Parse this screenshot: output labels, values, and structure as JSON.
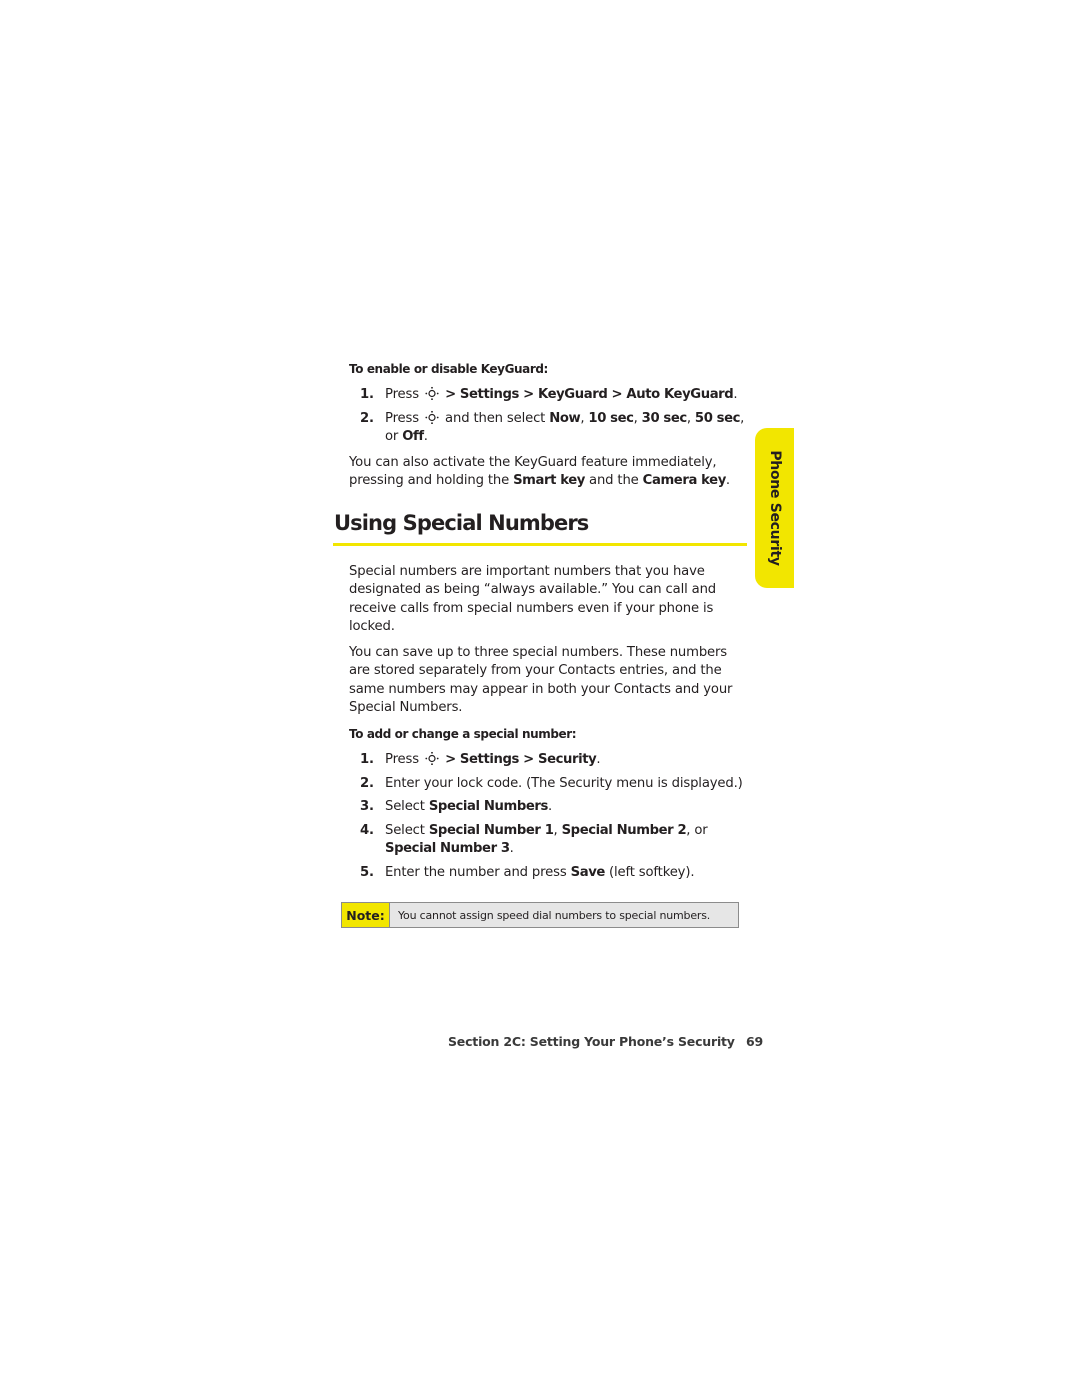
{
  "keyguard": {
    "subheading": "To enable or disable KeyGuard:",
    "steps": [
      {
        "num": "1.",
        "press": "Press",
        "path": "> Settings > KeyGuard > Auto KeyGuard",
        "end": "."
      },
      {
        "num": "2.",
        "press": "Press",
        "mid": " and then select ",
        "opt1": "Now",
        "sep1": ", ",
        "opt2": "10 sec",
        "sep2": ", ",
        "opt3": "30 sec",
        "sep3": ", ",
        "opt4": "50 sec",
        "sep4": ", or ",
        "opt5": "Off",
        "end": "."
      }
    ],
    "para_a": "You can also activate the KeyGuard feature immediately, pressing and holding the ",
    "smart_key": "Smart key",
    "para_b": " and the ",
    "camera_key": "Camera key",
    "para_end": "."
  },
  "section": {
    "heading": "Using Special Numbers",
    "tab_label": "Phone Security",
    "accent_color": "#f2e600",
    "para1": "Special numbers are important numbers that you have designated as being “always available.” You can call and receive calls from special numbers even if your phone is locked.",
    "para2": "You can save up to three special numbers. These numbers are stored separately from your Contacts entries, and the same numbers may appear in both your Contacts and your Special Numbers.",
    "subheading": "To add or change a special number:",
    "steps": [
      {
        "num": "1.",
        "press": "Press",
        "path": "> Settings > Security",
        "end": "."
      },
      {
        "num": "2.",
        "text": "Enter your lock code. (The Security menu is displayed.)"
      },
      {
        "num": "3.",
        "pre": "Select ",
        "bold": "Special Numbers",
        "end": "."
      },
      {
        "num": "4.",
        "pre": "Select ",
        "b1": "Special Number 1",
        "s1": ", ",
        "b2": "Special Number 2",
        "s2": ", or ",
        "b3": "Special Number 3",
        "end": "."
      },
      {
        "num": "5.",
        "pre": "Enter the number and press ",
        "bold": "Save",
        "end": " (left softkey)."
      }
    ],
    "note_label": "Note:",
    "note_text": "You cannot assign speed dial numbers to special numbers."
  },
  "footer": {
    "section_title": "Section 2C: Setting Your Phone’s Security",
    "page_number": "69"
  },
  "icons": {
    "nav_key": "navigation-key-icon"
  }
}
